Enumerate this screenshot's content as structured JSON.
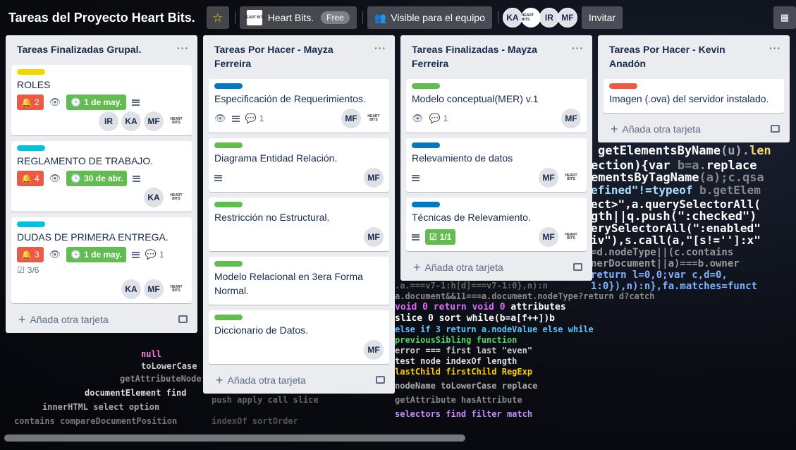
{
  "header": {
    "title": "Tareas del Proyecto Heart Bits.",
    "team_logo_text": "HEART BITS",
    "team_name": "Heart Bits.",
    "plan": "Free",
    "visibility": "Visible para el equipo",
    "members": [
      "KA",
      "IR",
      "MF"
    ],
    "invite_label": "Invitar"
  },
  "lists": [
    {
      "title": "Tareas Finalizadas Grupal.",
      "add_label": "Añada otra tarjeta",
      "cards": [
        {
          "label_color": "#f2d600",
          "title": "ROLES",
          "alerts": "2",
          "due": "1 de may.",
          "members": [
            "IR",
            "KA",
            "MF"
          ]
        },
        {
          "label_color": "#00c2e0",
          "title": "REGLAMENTO DE TRABAJO.",
          "alerts": "4",
          "due": "30 de abr.",
          "members": [
            "KA"
          ]
        },
        {
          "label_color": "#00c2e0",
          "title": "DUDAS DE PRIMERA ENTREGA.",
          "alerts": "3",
          "due": "1 de may.",
          "comments": "1",
          "checklist": "3/6",
          "members": [
            "KA",
            "MF"
          ]
        }
      ]
    },
    {
      "title": "Tareas Por Hacer - Mayza Ferreira",
      "add_label": "Añada otra tarjeta",
      "cards": [
        {
          "label_color": "#0079bf",
          "title": "Especificación de Requerimientos.",
          "comments": "1",
          "members": [
            "MF"
          ]
        },
        {
          "label_color": "#61bd4f",
          "title": "Diagrama Entidad Relación.",
          "members": [
            "MF"
          ]
        },
        {
          "label_color": "#61bd4f",
          "title": "Restricción no Estructural.",
          "members": [
            "MF"
          ]
        },
        {
          "label_color": "#61bd4f",
          "title": "Modelo Relacional en 3era Forma Normal."
        },
        {
          "label_color": "#61bd4f",
          "title": "Diccionario de Datos.",
          "members": [
            "MF"
          ]
        }
      ]
    },
    {
      "title": "Tareas Finalizadas - Mayza Ferreira",
      "add_label": "Añada otra tarjeta",
      "cards": [
        {
          "label_color": "#61bd4f",
          "title": "Modelo conceptual(MER) v.1",
          "comments": "1",
          "members": [
            "MF"
          ]
        },
        {
          "label_color": "#0079bf",
          "title": "Relevamiento de datos",
          "members": [
            "MF"
          ]
        },
        {
          "label_color": "#0079bf",
          "title": "Técnicas de Relevamiento.",
          "checklist": "1/1",
          "members": [
            "MF"
          ]
        }
      ]
    },
    {
      "title": "Tareas Por Hacer - Kevin Anadón",
      "add_label": "Añada otra tarjeta",
      "cards": [
        {
          "label_color": "#eb5a46",
          "title": "Imagen (.ova) del servidor instalado."
        }
      ]
    }
  ],
  "icons": [
    "star-icon",
    "eye-icon",
    "description-icon",
    "comment-icon",
    "alarm-icon",
    "clock-icon",
    "checklist-icon",
    "plus-icon",
    "card-template-icon",
    "calendar-icon",
    "ellipsis-icon"
  ]
}
